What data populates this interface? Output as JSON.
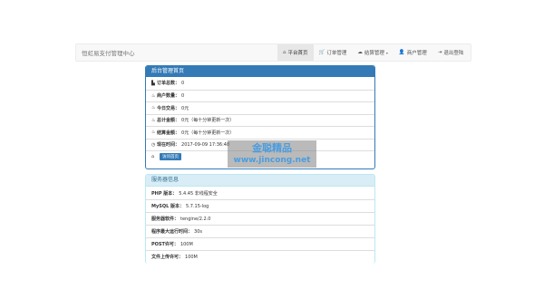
{
  "navbar": {
    "brand": "恒虹易支付管理中心",
    "items": [
      {
        "icon": "home-icon",
        "glyph": "⌂",
        "label": "平台首页",
        "active": true
      },
      {
        "icon": "cart-icon",
        "glyph": "🛒",
        "label": "订单管理",
        "active": false
      },
      {
        "icon": "cloud-icon",
        "glyph": "☁",
        "label": "结算管理",
        "caret": "▾",
        "active": false
      },
      {
        "icon": "user-icon",
        "glyph": "👤",
        "label": "商户管理",
        "active": false
      },
      {
        "icon": "logout-icon",
        "glyph": "⇥",
        "label": "退出登陆",
        "active": false
      }
    ]
  },
  "admin_panel": {
    "title": "后台管理首页",
    "rows": [
      {
        "icon": "stats-icon",
        "glyph": "▙",
        "label": "订单总数：",
        "value": "0"
      },
      {
        "icon": "fire-icon",
        "glyph": "♨",
        "label": "商户数量：",
        "value": "0"
      },
      {
        "icon": "fire-icon",
        "glyph": "♨",
        "label": "今日交易：",
        "value": "0元"
      },
      {
        "icon": "fire-icon",
        "glyph": "♨",
        "label": "总计金额：",
        "value": "0元（每十分钟更新一次）"
      },
      {
        "icon": "fire-icon",
        "glyph": "♨",
        "label": "结算金额：",
        "value": "0元（每十分钟更新一次）"
      },
      {
        "icon": "clock-icon",
        "glyph": "◷",
        "label": "现在时间：",
        "value": "2017-09-09 17:36:48"
      }
    ],
    "action": {
      "icon": "home-icon",
      "glyph": "⌂",
      "button": "访问首页"
    }
  },
  "server_panel": {
    "title": "服务器信息",
    "rows": [
      {
        "label": "PHP 版本：",
        "value": "5.4.45 非线程安全"
      },
      {
        "label": "MySQL 版本：",
        "value": "5.7.15-log"
      },
      {
        "label": "服务器软件：",
        "value": "tengine/2.2.0"
      },
      {
        "label": "程序最大运行时间：",
        "value": "30s"
      },
      {
        "label": "POST许可：",
        "value": "100M"
      },
      {
        "label": "文件上传许可：",
        "value": "100M"
      }
    ]
  },
  "watermark": {
    "title": "金聪精品",
    "url": "www.jincong.net"
  }
}
